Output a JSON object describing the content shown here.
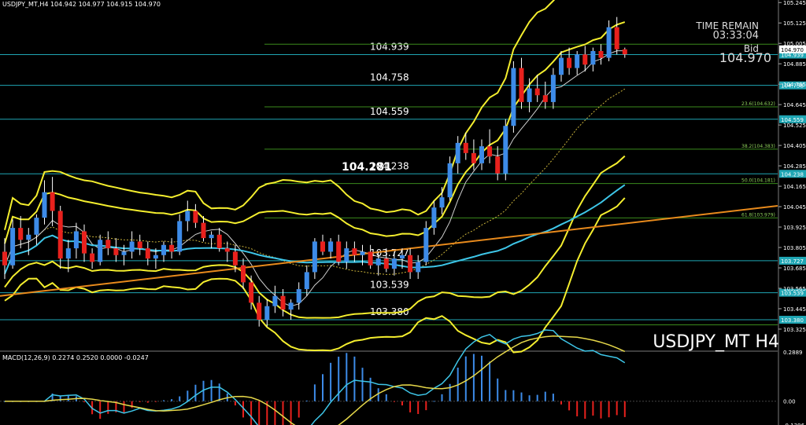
{
  "header": {
    "symbol_line": "USDJPY_MT,H4  104.942 104.977 104.915 104.970",
    "macd_line": "MACD(12,26,9) 0.2274 0.2520 0.0000 -0.0247"
  },
  "info": {
    "time_remain_label": "TIME REMAIN",
    "time_remain_value": "03:33:04",
    "bid_label": "Bid",
    "bid_value": "104.970",
    "symbol_label": "USDJPY_MT H4"
  },
  "colors": {
    "background": "#000000",
    "bull_candle": "#3d8be8",
    "bear_candle": "#e8211d",
    "bollinger": "#f4ee2e",
    "level_line": "#1fa6b4",
    "fibo_line": "#3a8a1c",
    "trend_line": "#e88a1c",
    "ma_fast": "#cfcfcf",
    "ma_slow": "#3ec6e8",
    "macd_signal": "#e6d84a"
  },
  "chart_data": [
    {
      "type": "candlestick",
      "ylim": [
        103.2,
        105.26
      ],
      "y_ticks": [
        "105.245",
        "105.125",
        "105.005",
        "104.885",
        "104.765",
        "104.645",
        "104.525",
        "104.405",
        "104.285",
        "104.165",
        "104.045",
        "103.925",
        "103.805",
        "103.685",
        "103.565",
        "103.445",
        "103.325"
      ],
      "candles": [
        [
          103.78,
          103.86,
          103.62,
          103.7
        ],
        [
          103.7,
          103.97,
          103.68,
          103.92
        ],
        [
          103.92,
          103.99,
          103.8,
          103.85
        ],
        [
          103.85,
          103.92,
          103.76,
          103.88
        ],
        [
          103.88,
          104.0,
          103.82,
          103.98
        ],
        [
          103.98,
          104.2,
          103.94,
          104.13
        ],
        [
          104.13,
          104.22,
          103.93,
          104.02
        ],
        [
          104.02,
          104.05,
          103.68,
          103.74
        ],
        [
          103.74,
          103.85,
          103.66,
          103.8
        ],
        [
          103.8,
          103.95,
          103.74,
          103.9
        ],
        [
          103.9,
          103.94,
          103.72,
          103.77
        ],
        [
          103.77,
          103.8,
          103.68,
          103.72
        ],
        [
          103.72,
          103.88,
          103.7,
          103.85
        ],
        [
          103.85,
          103.9,
          103.76,
          103.8
        ],
        [
          103.8,
          103.86,
          103.72,
          103.76
        ],
        [
          103.76,
          103.82,
          103.7,
          103.78
        ],
        [
          103.78,
          103.9,
          103.74,
          103.84
        ],
        [
          103.84,
          103.88,
          103.76,
          103.8
        ],
        [
          103.8,
          103.84,
          103.7,
          103.74
        ],
        [
          103.74,
          103.8,
          103.68,
          103.76
        ],
        [
          103.76,
          103.84,
          103.72,
          103.82
        ],
        [
          103.82,
          103.86,
          103.74,
          103.78
        ],
        [
          103.78,
          104.0,
          103.76,
          103.96
        ],
        [
          103.96,
          104.08,
          103.9,
          104.02
        ],
        [
          104.02,
          104.06,
          103.92,
          103.95
        ],
        [
          103.95,
          103.99,
          103.84,
          103.86
        ],
        [
          103.86,
          103.9,
          103.8,
          103.88
        ],
        [
          103.88,
          103.92,
          103.78,
          103.8
        ],
        [
          103.8,
          103.84,
          103.72,
          103.78
        ],
        [
          103.78,
          103.82,
          103.66,
          103.7
        ],
        [
          103.7,
          103.74,
          103.56,
          103.6
        ],
        [
          103.6,
          103.64,
          103.44,
          103.48
        ],
        [
          103.48,
          103.52,
          103.34,
          103.38
        ],
        [
          103.38,
          103.5,
          103.34,
          103.46
        ],
        [
          103.46,
          103.58,
          103.42,
          103.52
        ],
        [
          103.52,
          103.56,
          103.4,
          103.44
        ],
        [
          103.44,
          103.5,
          103.38,
          103.48
        ],
        [
          103.48,
          103.6,
          103.44,
          103.56
        ],
        [
          103.56,
          103.7,
          103.52,
          103.66
        ],
        [
          103.66,
          103.86,
          103.62,
          103.84
        ],
        [
          103.84,
          103.88,
          103.76,
          103.78
        ],
        [
          103.78,
          103.86,
          103.74,
          103.84
        ],
        [
          103.84,
          103.88,
          103.7,
          103.72
        ],
        [
          103.72,
          103.84,
          103.68,
          103.8
        ],
        [
          103.8,
          103.84,
          103.72,
          103.76
        ],
        [
          103.76,
          103.82,
          103.7,
          103.78
        ],
        [
          103.78,
          103.82,
          103.68,
          103.7
        ],
        [
          103.7,
          103.78,
          103.64,
          103.74
        ],
        [
          103.74,
          103.8,
          103.66,
          103.68
        ],
        [
          103.68,
          103.78,
          103.64,
          103.74
        ],
        [
          103.74,
          103.8,
          103.68,
          103.76
        ],
        [
          103.76,
          103.8,
          103.62,
          103.66
        ],
        [
          103.66,
          103.76,
          103.62,
          103.72
        ],
        [
          103.72,
          103.96,
          103.7,
          103.92
        ],
        [
          103.92,
          104.08,
          103.88,
          104.04
        ],
        [
          104.04,
          104.16,
          104.0,
          104.1
        ],
        [
          104.1,
          104.34,
          104.08,
          104.3
        ],
        [
          104.3,
          104.46,
          104.24,
          104.42
        ],
        [
          104.42,
          104.48,
          104.32,
          104.36
        ],
        [
          104.36,
          104.44,
          104.26,
          104.3
        ],
        [
          104.3,
          104.44,
          104.26,
          104.4
        ],
        [
          104.4,
          104.5,
          104.3,
          104.34
        ],
        [
          104.34,
          104.4,
          104.2,
          104.24
        ],
        [
          104.24,
          104.56,
          104.2,
          104.52
        ],
        [
          104.52,
          104.9,
          104.48,
          104.86
        ],
        [
          104.86,
          104.92,
          104.62,
          104.66
        ],
        [
          104.66,
          104.8,
          104.6,
          104.74
        ],
        [
          104.74,
          104.82,
          104.66,
          104.7
        ],
        [
          104.7,
          104.78,
          104.62,
          104.66
        ],
        [
          104.66,
          104.86,
          104.62,
          104.82
        ],
        [
          104.82,
          104.96,
          104.78,
          104.92
        ],
        [
          104.92,
          104.98,
          104.82,
          104.86
        ],
        [
          104.86,
          104.96,
          104.82,
          104.94
        ],
        [
          104.94,
          104.99,
          104.84,
          104.88
        ],
        [
          104.88,
          104.98,
          104.84,
          104.96
        ],
        [
          104.96,
          105.0,
          104.88,
          104.92
        ],
        [
          104.92,
          105.14,
          104.9,
          105.1
        ],
        [
          105.1,
          105.16,
          104.94,
          104.97
        ],
        [
          104.97,
          104.98,
          104.92,
          104.94
        ]
      ],
      "price_levels": [
        "104.939",
        "104.758",
        "104.559",
        "104.238",
        "103.727",
        "103.539",
        "103.380"
      ],
      "level_values": [
        104.939,
        104.758,
        104.559,
        104.238,
        103.727,
        103.539,
        103.38
      ],
      "fibo": [
        {
          "label": "23.6(104.632)",
          "value": 104.632
        },
        {
          "label": "38.2(104.383)",
          "value": 104.383
        },
        {
          "label": "50.0(104.181)",
          "value": 104.181
        },
        {
          "label": "61.8(103.979)",
          "value": 103.979
        }
      ],
      "price_marker": "104.281",
      "price_marker_value": 104.281
    },
    {
      "type": "bar",
      "title": "MACD(12,26,9) 0.2274 0.2520 0.0000 -0.0247",
      "ylim": [
        -0.1396,
        0.2889
      ],
      "y_ticks": [
        "0.2889",
        "0.00",
        "-0.1396"
      ]
    }
  ]
}
